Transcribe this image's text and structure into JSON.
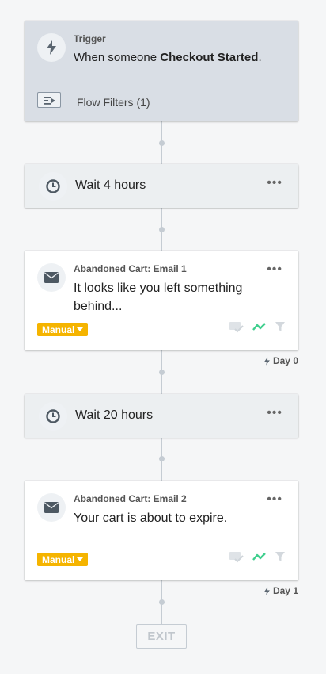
{
  "trigger": {
    "label": "Trigger",
    "text_prefix": "When someone ",
    "event": "Checkout Started",
    "text_suffix": ".",
    "filters_label": "Flow Filters (1)"
  },
  "wait1": {
    "label": "Wait 4 hours"
  },
  "email1": {
    "title": "Abandoned Cart: Email 1",
    "subject": "It looks like you left something behind...",
    "status": "Manual",
    "day": "Day 0"
  },
  "wait2": {
    "label": "Wait 20 hours"
  },
  "email2": {
    "title": "Abandoned Cart: Email 2",
    "subject": "Your cart is about to expire.",
    "status": "Manual",
    "day": "Day 1"
  },
  "more_label": "•••",
  "exit_label": "EXIT",
  "colors": {
    "manual_badge": "#f5b400",
    "trend_icon": "#3fcf8e",
    "connector": "#c5ccd3"
  }
}
